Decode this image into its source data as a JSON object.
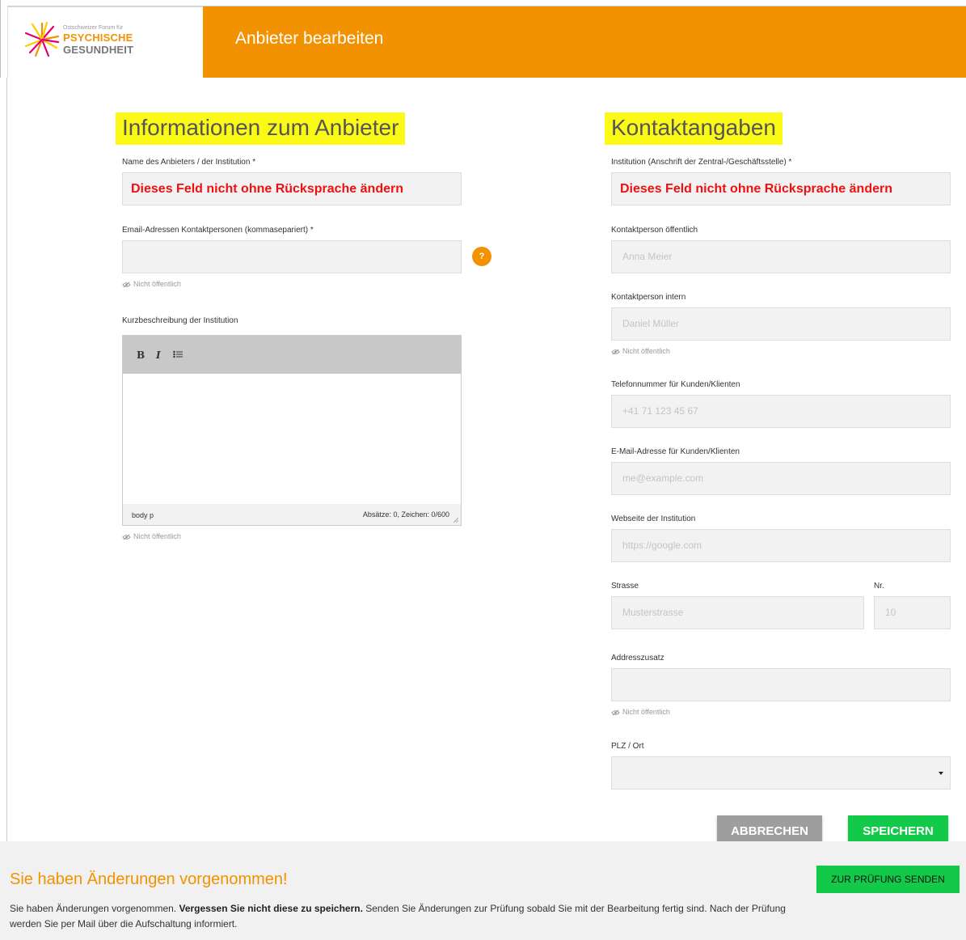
{
  "header": {
    "logo_small": "Ostschweizer Forum für",
    "logo_psy": "PSYCHISCHE",
    "logo_ges": "GESUNDHEIT",
    "title": "Anbieter bearbeiten"
  },
  "left": {
    "section_title": "Informationen zum Anbieter",
    "name_label": "Name des Anbieters / der Institution *",
    "name_value": "Dieses Feld nicht ohne Rücksprache ändern",
    "email_label": "Email-Adressen Kontaktpersonen (kommasepariert) *",
    "email_value": "",
    "help_icon": "?",
    "email_hint": "Nicht öffentlich",
    "desc_label": "Kurzbeschreibung der Institution",
    "toolbar_bold": "B",
    "toolbar_italic": "I",
    "toolbar_list": "⁝≡",
    "status_path": "body   p",
    "status_count": "Absätze: 0, Zeichen: 0/600",
    "desc_hint": "Nicht öffentlich"
  },
  "right": {
    "section_title": "Kontaktangaben",
    "institution_label": "Institution (Anschrift der Zentral-/Geschäftsstelle) *",
    "institution_value": "Dieses Feld nicht ohne Rücksprache ändern",
    "public_contact_label": "Kontaktperson öffentlich",
    "public_contact_placeholder": "Anna Meier",
    "internal_contact_label": "Kontaktperson intern",
    "internal_contact_placeholder": "Daniel Müller",
    "internal_hint": "Nicht öffentlich",
    "phone_label": "Telefonnummer für Kunden/Klienten",
    "phone_placeholder": "+41 71 123 45 67",
    "email_label": "E-Mail-Adresse für Kunden/Klienten",
    "email_placeholder": "me@example.com",
    "website_label": "Webseite der Institution",
    "website_placeholder": "https://google.com",
    "street_label": "Strasse",
    "street_placeholder": "Musterstrasse",
    "number_label": "Nr.",
    "number_placeholder": "10",
    "address_extra_label": "Addresszusatz",
    "address_hint": "Nicht öffentlich",
    "plz_label": "PLZ / Ort",
    "plz_value": ""
  },
  "actions": {
    "cancel": "ABBRECHEN",
    "save": "SPEICHERN"
  },
  "footer": {
    "title": "Sie haben Änderungen vorgenommen!",
    "text_1": "Sie haben Änderungen vorgenommen. ",
    "text_bold": "Vergessen Sie nicht diese zu speichern.",
    "text_2": " Senden Sie Änderungen zur Prüfung sobald Sie mit der Bearbeitung fertig sind. Nach der Prüfung werden Sie per Mail über die Aufschaltung informiert.",
    "review_button": "ZUR PRÜFUNG SENDEN"
  },
  "colors": {
    "brand_orange": "#f39200",
    "highlight_yellow": "#fbfa17",
    "warning_red": "#ee1111",
    "save_green": "#12c94a",
    "cancel_grey": "#9e9e9e"
  }
}
